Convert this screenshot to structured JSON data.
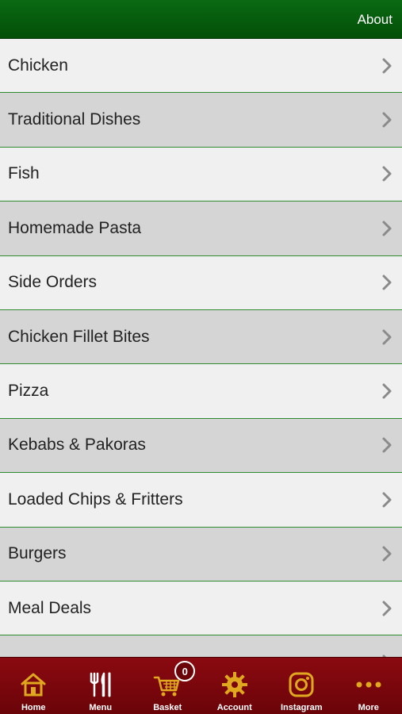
{
  "header": {
    "about_label": "About"
  },
  "menu": {
    "items": [
      {
        "label": "Chicken"
      },
      {
        "label": "Traditional Dishes"
      },
      {
        "label": "Fish"
      },
      {
        "label": "Homemade Pasta"
      },
      {
        "label": "Side Orders"
      },
      {
        "label": "Chicken Fillet Bites"
      },
      {
        "label": "Pizza"
      },
      {
        "label": "Kebabs & Pakoras"
      },
      {
        "label": "Loaded Chips & Fritters"
      },
      {
        "label": "Burgers"
      },
      {
        "label": "Meal Deals"
      },
      {
        "label": ""
      }
    ]
  },
  "tabbar": {
    "tabs": [
      {
        "label": "Home",
        "icon": "home-icon"
      },
      {
        "label": "Menu",
        "icon": "fork-knife-icon"
      },
      {
        "label": "Basket",
        "icon": "cart-icon"
      },
      {
        "label": "Account",
        "icon": "gear-icon"
      },
      {
        "label": "Instagram",
        "icon": "instagram-icon"
      },
      {
        "label": "More",
        "icon": "more-dots-icon"
      }
    ],
    "basket_count": "0"
  },
  "colors": {
    "header_green": "#0a6a12",
    "row_light": "#f0f0f0",
    "row_dark": "#d5d5d5",
    "divider_green": "#2f8a2f",
    "tabbar_red": "#8a0a10",
    "icon_gold": "#e0a81e"
  }
}
